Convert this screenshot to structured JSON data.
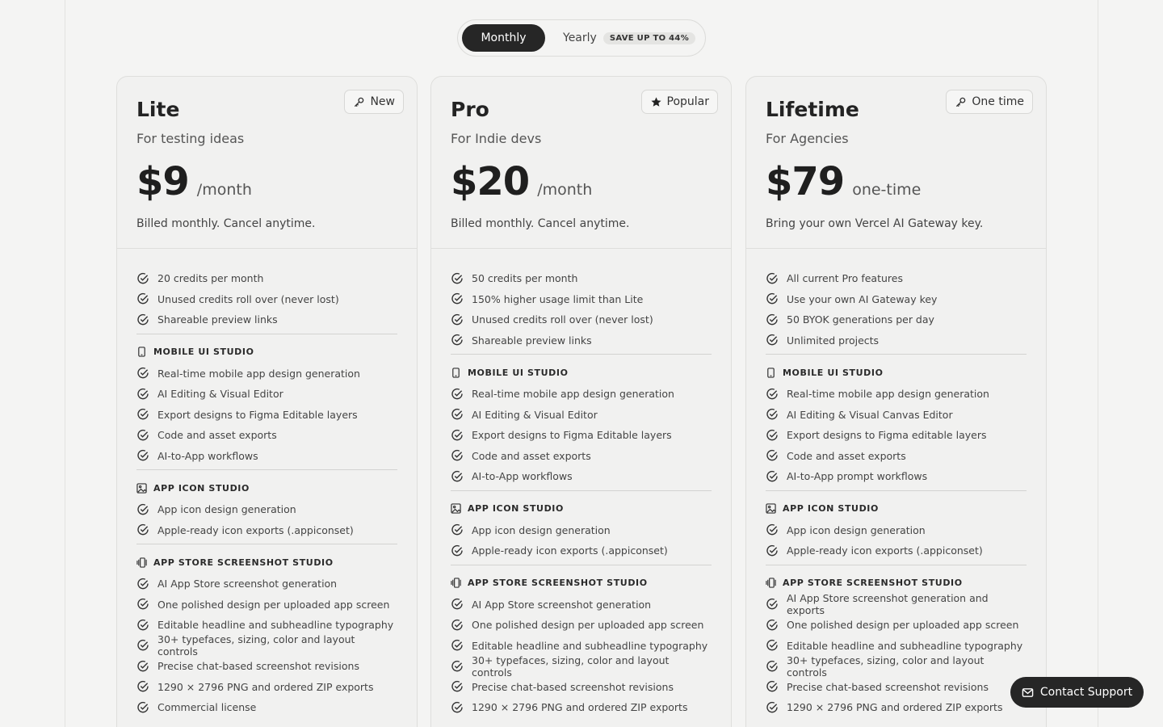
{
  "billing_toggle": {
    "monthly_label": "Monthly",
    "yearly_label": "Yearly",
    "save_badge": "SAVE UP TO 44%",
    "selected": "Monthly"
  },
  "plans": [
    {
      "name": "Lite",
      "badge": "New",
      "badge_icon": "key-icon",
      "tagline": "For testing ideas",
      "price": "$9",
      "period": "/month",
      "billing_note": "Billed monthly. Cancel anytime.",
      "base_features": [
        "20 credits per month",
        "Unused credits roll over (never lost)",
        "Shareable preview links"
      ],
      "sections": [
        {
          "title": "MOBILE UI STUDIO",
          "icon": "phone-icon",
          "items": [
            "Real-time mobile app design generation",
            "AI Editing & Visual Editor",
            "Export designs to Figma Editable layers",
            "Code and asset exports",
            "AI-to-App workflows"
          ]
        },
        {
          "title": "APP ICON STUDIO",
          "icon": "image-icon",
          "items": [
            "App icon design generation",
            "Apple-ready icon exports (.appiconset)"
          ]
        },
        {
          "title": "APP STORE SCREENSHOT STUDIO",
          "icon": "screenshots-icon",
          "items": [
            "AI App Store screenshot generation",
            "One polished design per uploaded app screen",
            "Editable headline and subheadline typography",
            "30+ typefaces, sizing, color and layout controls",
            "Precise chat-based screenshot revisions",
            "1290 × 2796 PNG and ordered ZIP exports",
            "Commercial license"
          ]
        }
      ]
    },
    {
      "name": "Pro",
      "badge": "Popular",
      "badge_icon": "star-icon",
      "tagline": "For Indie devs",
      "price": "$20",
      "period": "/month",
      "billing_note": "Billed monthly. Cancel anytime.",
      "base_features": [
        "50 credits per month",
        "150% higher usage limit than Lite",
        "Unused credits roll over (never lost)",
        "Shareable preview links"
      ],
      "sections": [
        {
          "title": "MOBILE UI STUDIO",
          "icon": "phone-icon",
          "items": [
            "Real-time mobile app design generation",
            "AI Editing & Visual Editor",
            "Export designs to Figma Editable layers",
            "Code and asset exports",
            "AI-to-App workflows"
          ]
        },
        {
          "title": "APP ICON STUDIO",
          "icon": "image-icon",
          "items": [
            "App icon design generation",
            "Apple-ready icon exports (.appiconset)"
          ]
        },
        {
          "title": "APP STORE SCREENSHOT STUDIO",
          "icon": "screenshots-icon",
          "items": [
            "AI App Store screenshot generation",
            "One polished design per uploaded app screen",
            "Editable headline and subheadline typography",
            "30+ typefaces, sizing, color and layout controls",
            "Precise chat-based screenshot revisions",
            "1290 × 2796 PNG and ordered ZIP exports"
          ]
        }
      ]
    },
    {
      "name": "Lifetime",
      "badge": "One time",
      "badge_icon": "key-icon",
      "tagline": "For Agencies",
      "price": "$79",
      "period": "one-time",
      "billing_note": "Bring your own Vercel AI Gateway key.",
      "base_features": [
        "All current Pro features",
        "Use your own AI Gateway key",
        "50 BYOK generations per day",
        "Unlimited projects"
      ],
      "sections": [
        {
          "title": "MOBILE UI STUDIO",
          "icon": "phone-icon",
          "items": [
            "Real-time mobile app design generation",
            "AI Editing & Visual Canvas Editor",
            "Export designs to Figma editable layers",
            "Code and asset exports",
            "AI-to-App prompt workflows"
          ]
        },
        {
          "title": "APP ICON STUDIO",
          "icon": "image-icon",
          "items": [
            "App icon design generation",
            "Apple-ready icon exports (.appiconset)"
          ]
        },
        {
          "title": "APP STORE SCREENSHOT STUDIO",
          "icon": "screenshots-icon",
          "items": [
            "AI App Store screenshot generation and exports",
            "One polished design per uploaded app screen",
            "Editable headline and subheadline typography",
            "30+ typefaces, sizing, color and layout controls",
            "Precise chat-based screenshot revisions",
            "1290 × 2796 PNG and ordered ZIP exports"
          ]
        }
      ]
    }
  ],
  "contact_support": {
    "label": "Contact Support",
    "icon": "mail-icon"
  }
}
